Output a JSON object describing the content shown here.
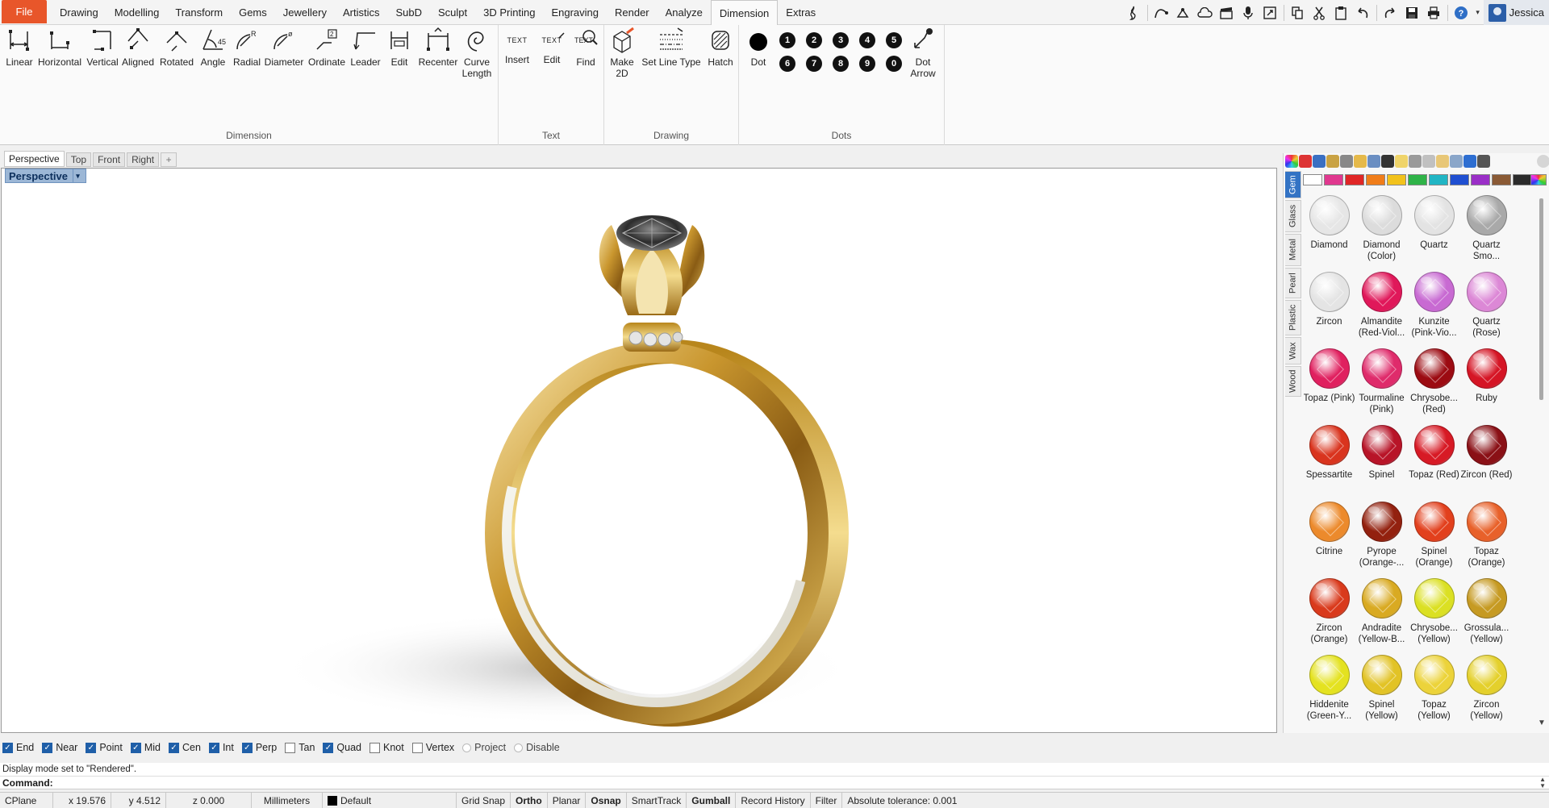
{
  "menubar": {
    "file": "File",
    "tabs": [
      "Drawing",
      "Modelling",
      "Transform",
      "Gems",
      "Jewellery",
      "Artistics",
      "SubD",
      "Sculpt",
      "3D Printing",
      "Engraving",
      "Render",
      "Analyze",
      "Dimension",
      "Extras"
    ],
    "active_tab": "Dimension",
    "user": "Jessica"
  },
  "ribbon": {
    "groups": {
      "dimension": "Dimension",
      "text": "Text",
      "drawing": "Drawing",
      "dots": "Dots"
    },
    "dimension_buttons": [
      "Linear",
      "Horizontal",
      "Vertical",
      "Aligned",
      "Rotated",
      "Angle",
      "Radial",
      "Diameter",
      "Ordinate",
      "Leader",
      "Edit",
      "Recenter"
    ],
    "curve_length": [
      "Curve",
      "Length"
    ],
    "text_buttons": [
      "Insert",
      "Edit",
      "Find"
    ],
    "text_icon_label": "TEXT",
    "make2d": [
      "Make",
      "2D"
    ],
    "set_line_type": "Set Line Type",
    "hatch": "Hatch",
    "dot": "Dot",
    "dot_numbers_row1": [
      "1",
      "2",
      "3",
      "4",
      "5"
    ],
    "dot_numbers_row2": [
      "6",
      "7",
      "8",
      "9",
      "0"
    ],
    "dot_arrow": [
      "Dot",
      "Arrow"
    ]
  },
  "viewport_tabs": [
    "Perspective",
    "Top",
    "Front",
    "Right"
  ],
  "viewport_tab_add": "+",
  "viewport": {
    "title": "Perspective",
    "dropdown": "▾"
  },
  "panel": {
    "vertical_tabs": [
      "Gem",
      "Glass",
      "Metal",
      "Pearl",
      "Plastic",
      "Wax",
      "Wood"
    ],
    "active_vertical_tab": "Gem",
    "swatches": [
      "#ffffff",
      "#e0388f",
      "#e02626",
      "#f07d1a",
      "#f2c21b",
      "#2fb348",
      "#21b5c4",
      "#1f4fd1",
      "#9a2fc7",
      "#8a5a35",
      "#2b2b2b"
    ],
    "gems": [
      {
        "name": "Diamond",
        "color": "#e6e6e6"
      },
      {
        "name": "Diamond (Color)",
        "color": "#dcdcdc"
      },
      {
        "name": "Quartz",
        "color": "#e3e3e3"
      },
      {
        "name": "Quartz Smo...",
        "color": "#a9a9a9"
      },
      {
        "name": "Zircon",
        "color": "#e4e4e4"
      },
      {
        "name": "Almandite (Red-Viol...",
        "color": "#e0185a"
      },
      {
        "name": "Kunzite (Pink-Vio...",
        "color": "#c86ad2"
      },
      {
        "name": "Quartz (Rose)",
        "color": "#dc88d6"
      },
      {
        "name": "Topaz (Pink)",
        "color": "#e0205f"
      },
      {
        "name": "Tourmaline (Pink)",
        "color": "#df2b6b"
      },
      {
        "name": "Chrysobe... (Red)",
        "color": "#9c0b12"
      },
      {
        "name": "Ruby",
        "color": "#d51525"
      },
      {
        "name": "Spessartite",
        "color": "#d9341e"
      },
      {
        "name": "Spinel",
        "color": "#b81428"
      },
      {
        "name": "Topaz (Red)",
        "color": "#d71a25"
      },
      {
        "name": "Zircon (Red)",
        "color": "#8a1016"
      },
      {
        "name": "Citrine",
        "color": "#ec8a2c"
      },
      {
        "name": "Pyrope (Orange-...",
        "color": "#93210f"
      },
      {
        "name": "Spinel (Orange)",
        "color": "#e2401d"
      },
      {
        "name": "Topaz (Orange)",
        "color": "#e8612a"
      },
      {
        "name": "Zircon (Orange)",
        "color": "#d93a1c"
      },
      {
        "name": "Andradite (Yellow-B...",
        "color": "#d9aa22"
      },
      {
        "name": "Chrysobe... (Yellow)",
        "color": "#dbe023"
      },
      {
        "name": "Grossula... (Yellow)",
        "color": "#c69a22"
      },
      {
        "name": "Hiddenite (Green-Y...",
        "color": "#e4e220"
      },
      {
        "name": "Spinel (Yellow)",
        "color": "#e2c326"
      },
      {
        "name": "Topaz (Yellow)",
        "color": "#ecd33a"
      },
      {
        "name": "Zircon (Yellow)",
        "color": "#e4d02c"
      }
    ]
  },
  "osnaps": [
    {
      "label": "End",
      "checked": true
    },
    {
      "label": "Near",
      "checked": true
    },
    {
      "label": "Point",
      "checked": true
    },
    {
      "label": "Mid",
      "checked": true
    },
    {
      "label": "Cen",
      "checked": true
    },
    {
      "label": "Int",
      "checked": true
    },
    {
      "label": "Perp",
      "checked": true
    },
    {
      "label": "Tan",
      "checked": false
    },
    {
      "label": "Quad",
      "checked": true
    },
    {
      "label": "Knot",
      "checked": false
    },
    {
      "label": "Vertex",
      "checked": false
    }
  ],
  "osnap_radios": [
    "Project",
    "Disable"
  ],
  "command": {
    "history": "Display mode set to \"Rendered\".",
    "prompt": "Command:"
  },
  "statusbar": {
    "cplane": "CPlane",
    "x": "x 19.576",
    "y": "y 4.512",
    "z": "z 0.000",
    "units": "Millimeters",
    "layer": "Default",
    "grid_snap": "Grid Snap",
    "ortho": "Ortho",
    "planar": "Planar",
    "osnap": "Osnap",
    "smarttrack": "SmartTrack",
    "gumball": "Gumball",
    "record_history": "Record History",
    "filter": "Filter",
    "tolerance": "Absolute tolerance: 0.001"
  }
}
